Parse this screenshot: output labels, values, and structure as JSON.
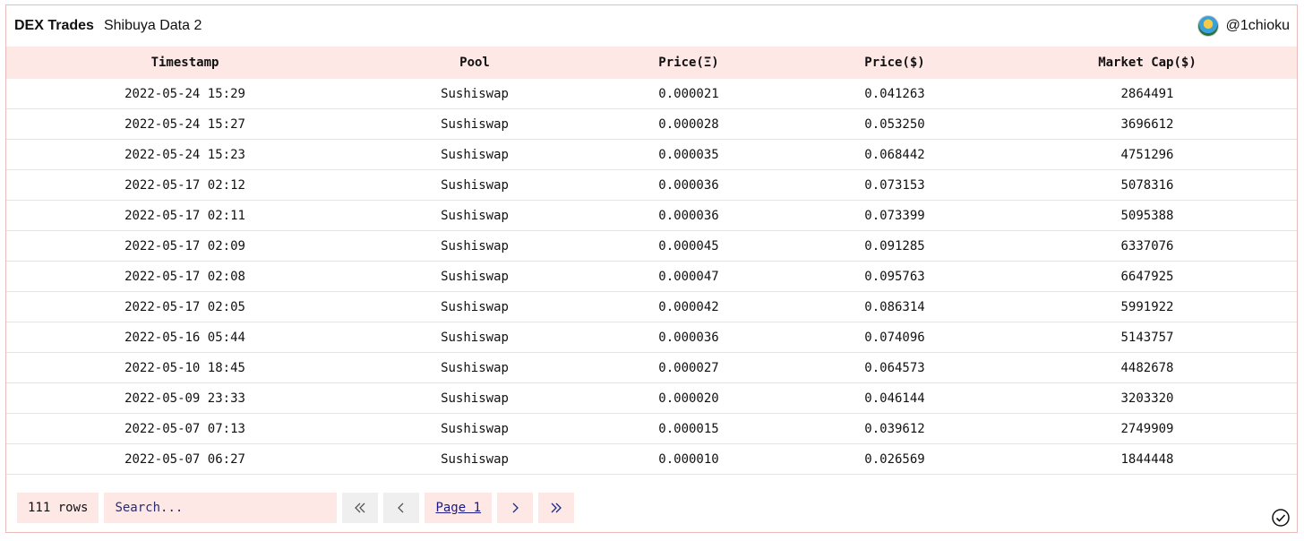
{
  "header": {
    "title": "DEX Trades",
    "subtitle": "Shibuya Data 2",
    "username": "@1chioku",
    "avatar_icon": "avatar-icon"
  },
  "table": {
    "columns": [
      "Timestamp",
      "Pool",
      "Price(Ξ)",
      "Price($)",
      "Market Cap($)"
    ],
    "rows": [
      [
        "2022-05-24 15:29",
        "Sushiswap",
        "0.000021",
        "0.041263",
        "2864491"
      ],
      [
        "2022-05-24 15:27",
        "Sushiswap",
        "0.000028",
        "0.053250",
        "3696612"
      ],
      [
        "2022-05-24 15:23",
        "Sushiswap",
        "0.000035",
        "0.068442",
        "4751296"
      ],
      [
        "2022-05-17 02:12",
        "Sushiswap",
        "0.000036",
        "0.073153",
        "5078316"
      ],
      [
        "2022-05-17 02:11",
        "Sushiswap",
        "0.000036",
        "0.073399",
        "5095388"
      ],
      [
        "2022-05-17 02:09",
        "Sushiswap",
        "0.000045",
        "0.091285",
        "6337076"
      ],
      [
        "2022-05-17 02:08",
        "Sushiswap",
        "0.000047",
        "0.095763",
        "6647925"
      ],
      [
        "2022-05-17 02:05",
        "Sushiswap",
        "0.000042",
        "0.086314",
        "5991922"
      ],
      [
        "2022-05-16 05:44",
        "Sushiswap",
        "0.000036",
        "0.074096",
        "5143757"
      ],
      [
        "2022-05-10 18:45",
        "Sushiswap",
        "0.000027",
        "0.064573",
        "4482678"
      ],
      [
        "2022-05-09 23:33",
        "Sushiswap",
        "0.000020",
        "0.046144",
        "3203320"
      ],
      [
        "2022-05-07 07:13",
        "Sushiswap",
        "0.000015",
        "0.039612",
        "2749909"
      ],
      [
        "2022-05-07 06:27",
        "Sushiswap",
        "0.000010",
        "0.026569",
        "1844448"
      ]
    ]
  },
  "footer": {
    "rows_count": "111 rows",
    "search_placeholder": "Search...",
    "first_icon": "«",
    "prev_icon": "‹",
    "page_label": "Page 1",
    "next_icon": "›",
    "last_icon": "»"
  },
  "colors": {
    "accent_bg": "#fde8e6",
    "border": "#e9bbb9",
    "link": "#1a1a8a"
  }
}
